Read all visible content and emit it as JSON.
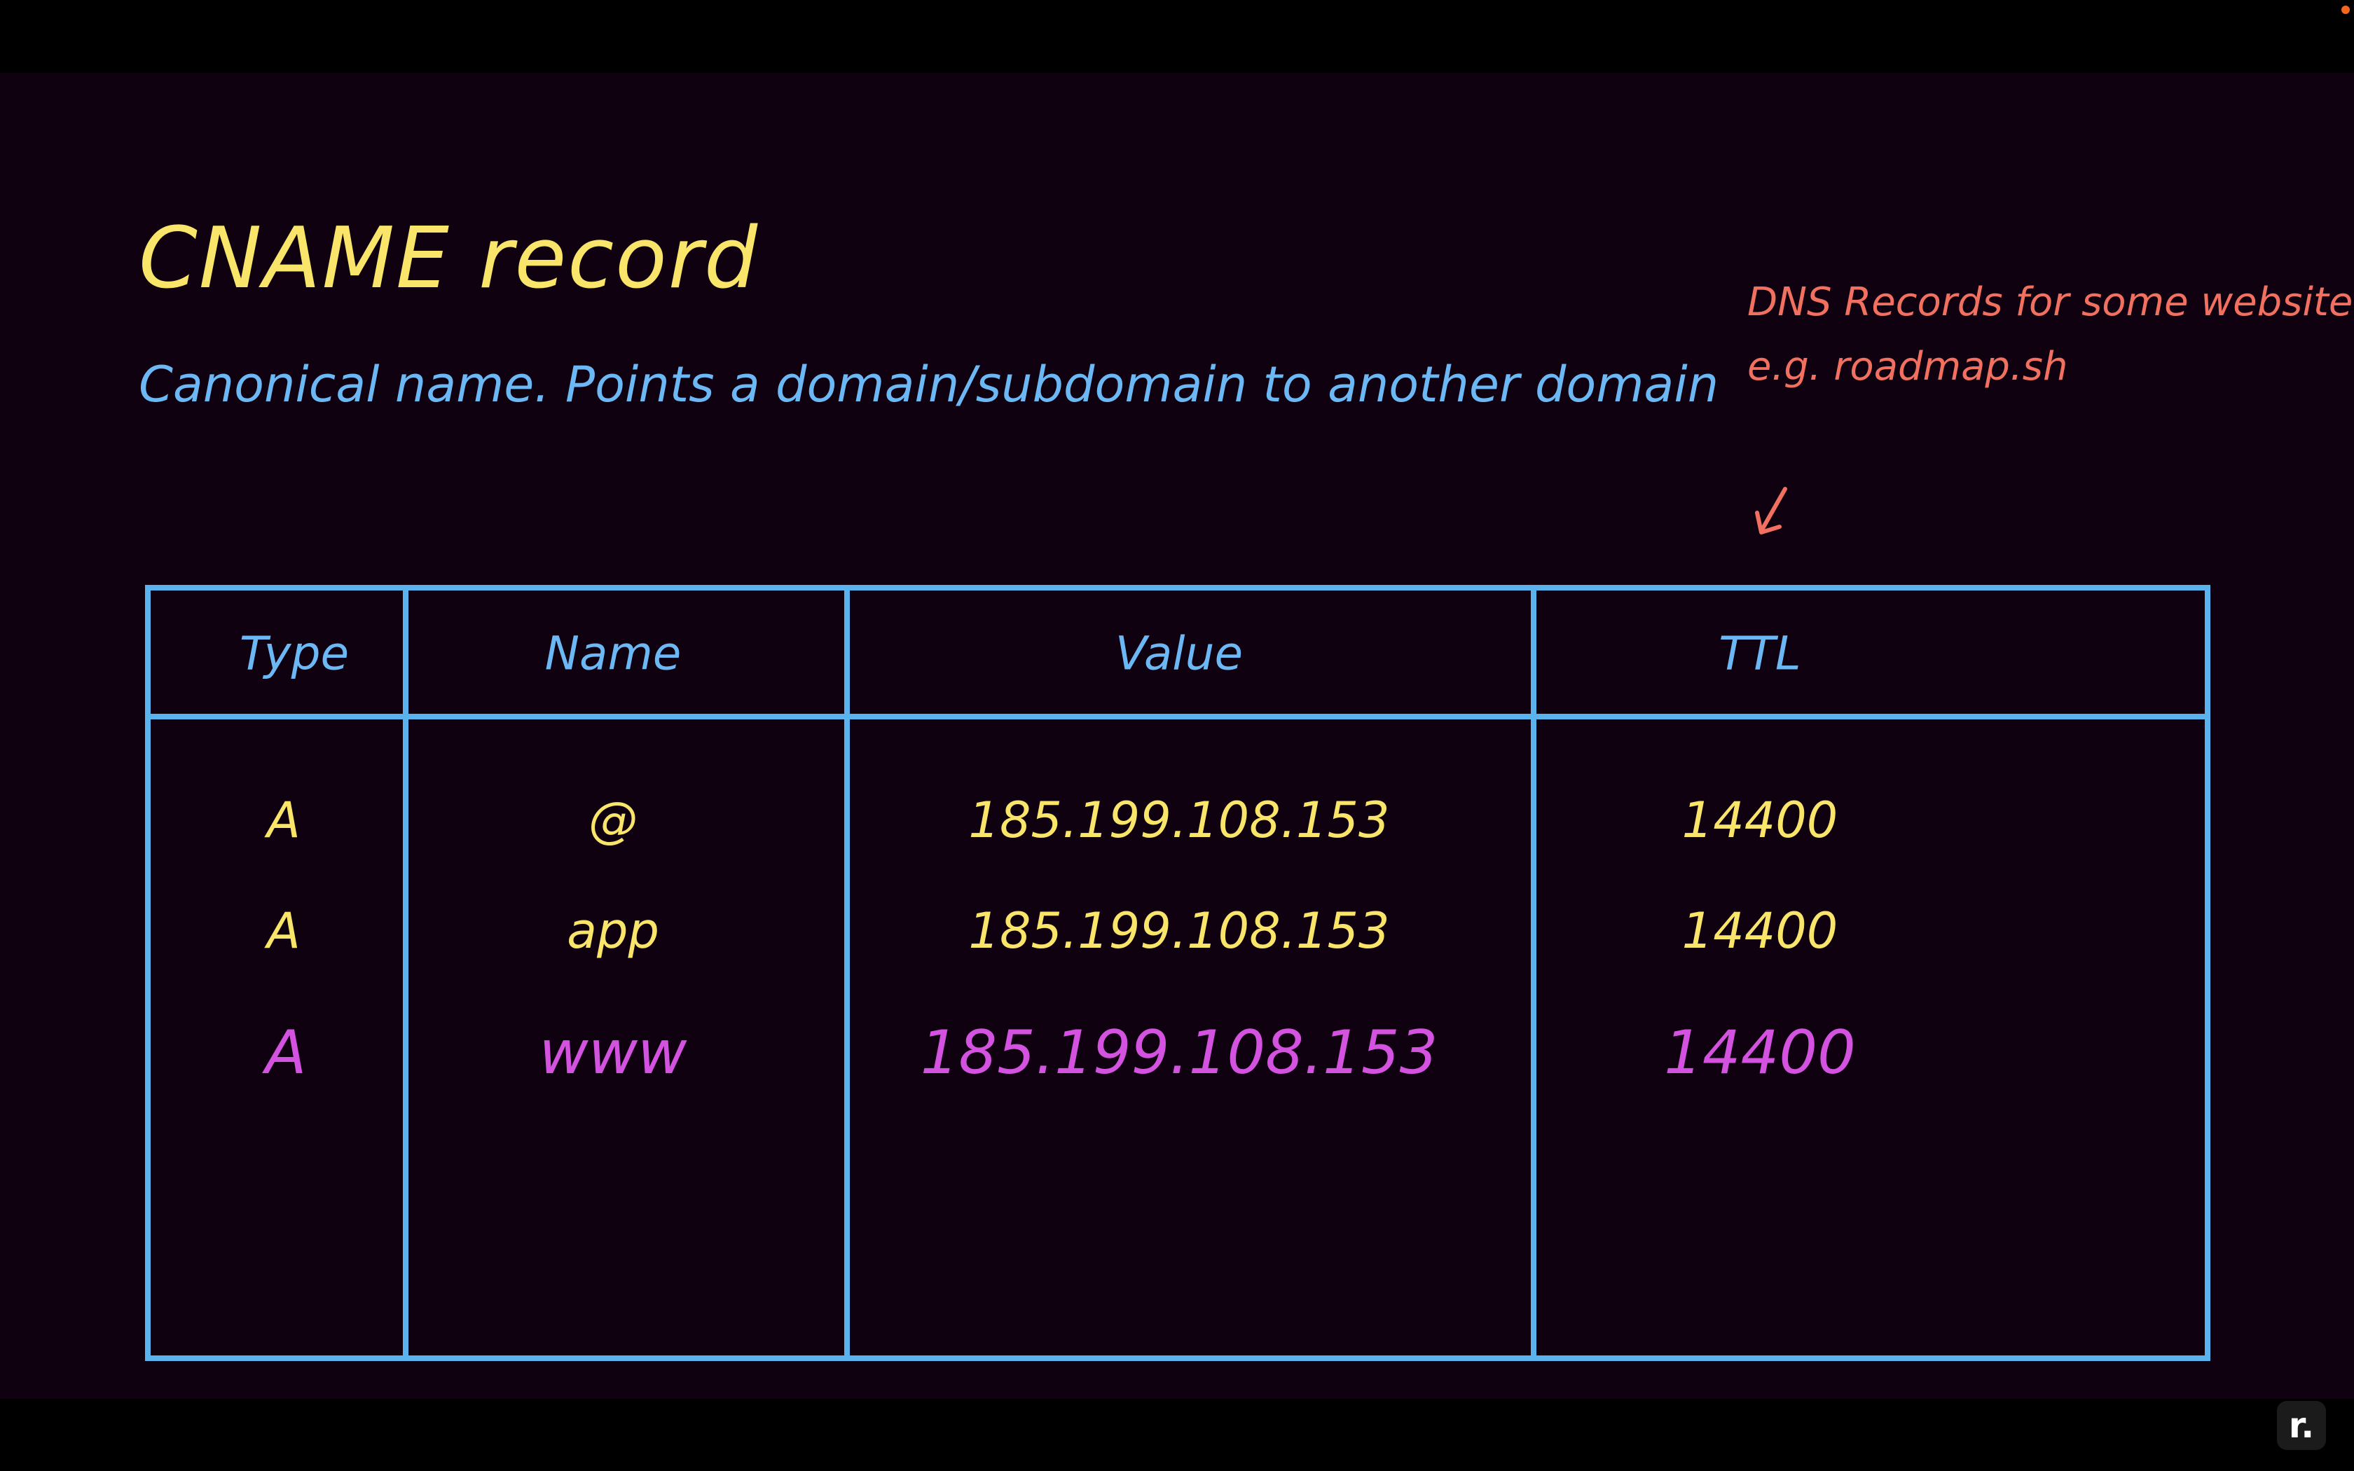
{
  "slide": {
    "title": "CNAME record",
    "subtitle": "Canonical name. Points a domain/subdomain to another domain",
    "note_line1": "DNS Records for some website",
    "note_line2": "e.g. roadmap.sh"
  },
  "table": {
    "headers": [
      "Type",
      "Name",
      "Value",
      "TTL"
    ],
    "rows": [
      [
        "A",
        "@",
        "185.199.108.153",
        "14400"
      ],
      [
        "A",
        "app",
        "185.199.108.153",
        "14400"
      ],
      [
        "A",
        "www",
        "185.199.108.153",
        "14400"
      ]
    ],
    "highlighted_row": 3
  },
  "colors": {
    "background": "#0f0110",
    "title": "#f8e56a",
    "subtitle": "#6cb8f4",
    "note": "#f1705f",
    "table_border": "#5ab3ec",
    "highlight": "#d452e0"
  },
  "logo": {
    "glyph": "r."
  }
}
